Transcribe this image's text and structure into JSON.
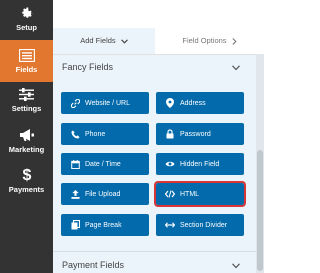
{
  "sidebar": {
    "items": [
      {
        "label": "Setup",
        "icon": "gear-icon"
      },
      {
        "label": "Fields",
        "icon": "fields-list-icon",
        "active": true
      },
      {
        "label": "Settings",
        "icon": "sliders-icon"
      },
      {
        "label": "Marketing",
        "icon": "megaphone-icon"
      },
      {
        "label": "Payments",
        "icon": "dollar-icon"
      }
    ]
  },
  "tabs": {
    "add_fields": "Add Fields",
    "field_options": "Field Options"
  },
  "fancy_fields": {
    "title": "Fancy Fields",
    "buttons": [
      {
        "label": "Website / URL",
        "icon": "link-icon"
      },
      {
        "label": "Address",
        "icon": "map-marker-icon"
      },
      {
        "label": "Phone",
        "icon": "phone-icon"
      },
      {
        "label": "Password",
        "icon": "lock-icon"
      },
      {
        "label": "Date / Time",
        "icon": "calendar-icon"
      },
      {
        "label": "Hidden Field",
        "icon": "eye-slash-icon"
      },
      {
        "label": "File Upload",
        "icon": "upload-icon"
      },
      {
        "label": "HTML",
        "icon": "code-icon",
        "highlighted": true
      },
      {
        "label": "Page Break",
        "icon": "copy-icon"
      },
      {
        "label": "Section Divider",
        "icon": "arrows-h-icon"
      }
    ]
  },
  "payment_fields": {
    "title": "Payment Fields"
  },
  "colors": {
    "sidebar_bg": "#333333",
    "active_nav": "#e27730",
    "button_blue": "#036aab",
    "highlight_red": "#d63638",
    "panel_bg": "#ebf3fb"
  }
}
